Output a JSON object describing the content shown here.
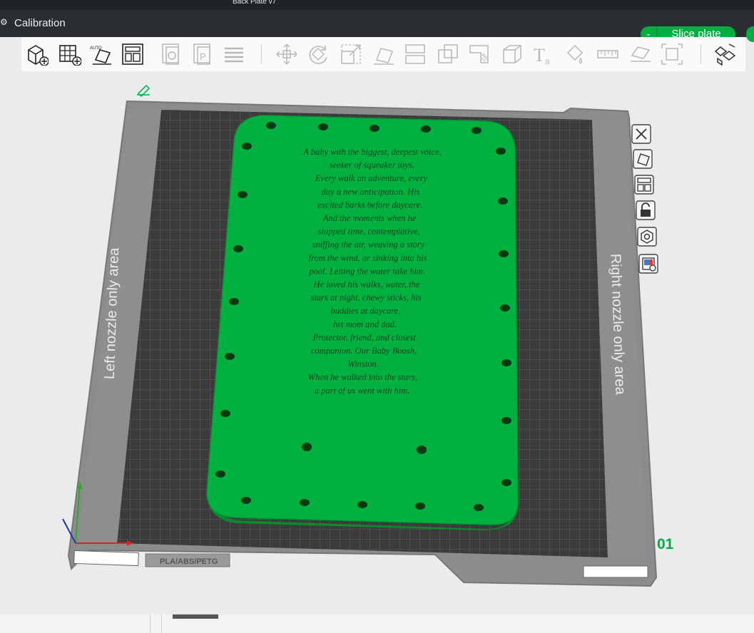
{
  "window": {
    "title": "Back Plate v7"
  },
  "header": {
    "menu_label": "Calibration",
    "slice_button": "Slice plate",
    "gear_icon": "gear-icon"
  },
  "toolbar": {
    "icons": [
      "add-cube-icon",
      "add-grid-icon",
      "auto-orient-icon",
      "arrange-icon",
      "copy-plate-icon",
      "plate-icon",
      "layers-icon",
      "move-icon",
      "rotate-icon",
      "scale-icon",
      "lay-on-face-icon",
      "split-icon",
      "cut-icon",
      "boolean-icon",
      "support-paint-icon",
      "text-icon",
      "color-paint-icon",
      "measure-icon",
      "assembly-icon",
      "explode-icon",
      "assembly-view-icon"
    ]
  },
  "plate": {
    "left_label": "Left nozzle only area",
    "right_label": "Right nozzle only area",
    "plate_number": "01",
    "sticker": "PLA/ABS/PETG",
    "edit_icon": "pencil-icon"
  },
  "engraving_lines": [
    "A baby with the biggest, deepest voice,",
    "seeker of squeaker toys.",
    "Every walk an adventure, every",
    "day a new anticipation. His",
    "excited barks before daycare.",
    "And the moments when he",
    "stopped time, contemplative,",
    "sniffing the air, weaving a story",
    "from the wind, or sinking into his",
    "pool. Letting the water take him.",
    "He loved his walks, water, the",
    "stars at night, chewy sticks, his",
    "buddies at daycare,",
    "his mom and dad.",
    "Protector, friend, and closest",
    "companion. Our Baby Boosh,",
    "Winston.",
    "When he walked into the stars,",
    "a part of us went with him."
  ],
  "side_tools": [
    "close-icon",
    "orient-icon",
    "arrange-icon",
    "lock-icon",
    "settings-icon",
    "slice-preview-icon"
  ],
  "colors": {
    "accent": "#00ae42",
    "part": "#00b140",
    "plate": "#8c8c8c",
    "bed": "#3b3b3b"
  }
}
